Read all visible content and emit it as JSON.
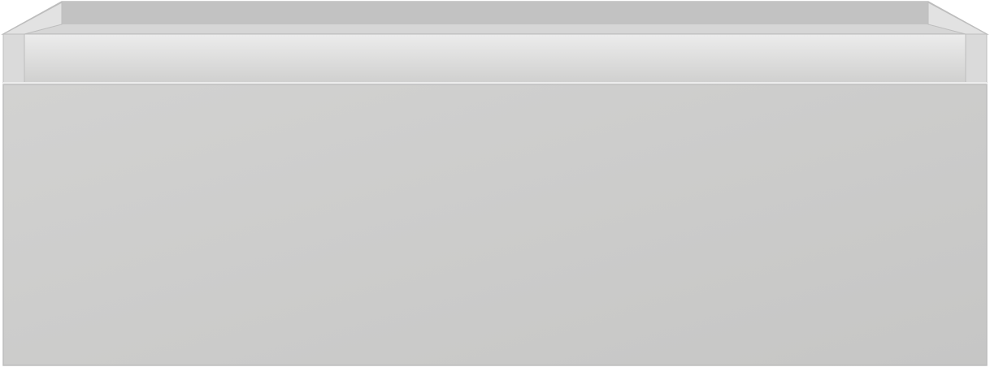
{
  "object": {
    "colors": {
      "outline": "#bdbdbd",
      "rim_top": "#d6d6d6",
      "inner_back": "#c2c2c2",
      "inner_side": "#e2e2e2",
      "lip_front": "#d0d0cf",
      "lip_highlight": "#ececec",
      "front_light": "#d2d2d1",
      "front_dark": "#c6c6c5",
      "corner_post": "#dadada"
    }
  }
}
